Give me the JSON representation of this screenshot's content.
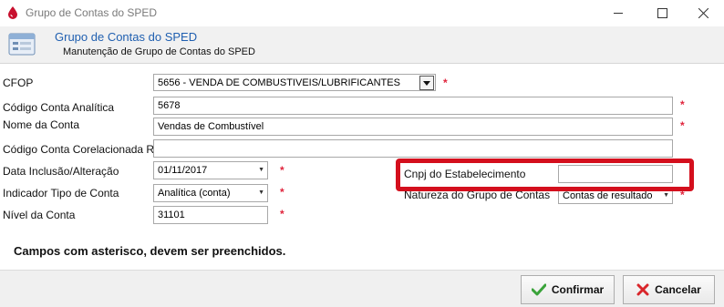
{
  "window": {
    "title": "Grupo de Contas do SPED"
  },
  "header": {
    "title": "Grupo de Contas do SPED",
    "subtitle": "Manutenção de Grupo de Contas do SPED"
  },
  "form": {
    "cfop": {
      "label": "CFOP",
      "value": "5656  - VENDA DE COMBUSTIVEIS/LUBRIFICANTES"
    },
    "codigo_conta_analitica": {
      "label": "Código Conta Analítica",
      "value": "5678"
    },
    "nome_da_conta": {
      "label": "Nome da Conta",
      "value": "Vendas de Combustível"
    },
    "codigo_conta_rfb": {
      "label": "Código Conta Corelacionada RFB",
      "value": ""
    },
    "data_inclusao": {
      "label": "Data Inclusão/Alteração",
      "value": "01/11/2017"
    },
    "indicador_tipo": {
      "label": "Indicador Tipo de Conta",
      "value": "Analítica (conta)"
    },
    "nivel_conta": {
      "label": "Nível da Conta",
      "value": "31101"
    },
    "cnpj_estabelecimento": {
      "label": "Cnpj do Estabelecimento",
      "value": ""
    },
    "natureza_grupo": {
      "label": "Natureza do Grupo de Contas",
      "value": "Contas de resultado"
    },
    "required_marker": "*"
  },
  "note": "Campos com asterisco, devem ser preenchidos.",
  "buttons": {
    "confirm": "Confirmar",
    "cancel": "Cancelar"
  },
  "colors": {
    "accent_title": "#1f5fb0",
    "required": "#e0243c",
    "highlight": "#d40f1d"
  },
  "icons": {
    "app": "blood-drop-icon",
    "header": "form-window-icon",
    "confirm": "check-icon",
    "cancel": "x-icon"
  }
}
